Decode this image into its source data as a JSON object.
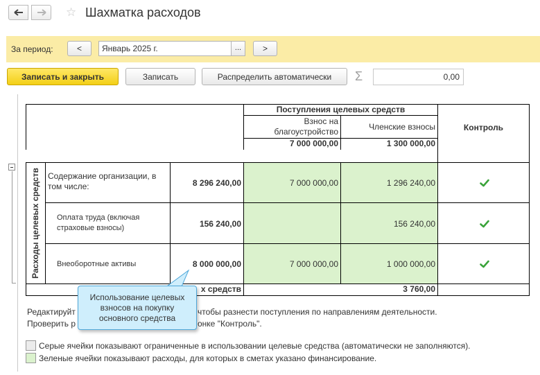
{
  "header": {
    "title": "Шахматка расходов"
  },
  "period": {
    "label": "За период:",
    "prev": "<",
    "next": ">",
    "value": "Январь 2025 г.",
    "picker": "..."
  },
  "toolbar": {
    "save_close": "Записать и закрыть",
    "save": "Записать",
    "auto_distribute": "Распределить автоматически",
    "sum_value": "0,00"
  },
  "grid": {
    "income_group": "Поступления целевых средств",
    "control_header": "Контроль",
    "columns": [
      {
        "label": "Взнос на благоустройство",
        "total": "7 000 000,00"
      },
      {
        "label": "Членские взносы",
        "total": "1 300 000,00"
      }
    ],
    "expense_group": "Расходы целевых средств",
    "rows": [
      {
        "name": "Содержание организации, в том числе:",
        "total": "8 296 240,00",
        "col1": "7 000 000,00",
        "col2": "1 296 240,00"
      },
      {
        "name": "Оплата труда (включая страховые взносы)",
        "total": "156 240,00",
        "col1": "",
        "col2": "156 240,00"
      },
      {
        "name": "Внеоборотные активы",
        "total": "8 000 000,00",
        "col1": "7 000 000,00",
        "col2": "1 000 000,00"
      }
    ],
    "remainder_label": "х средств",
    "remainder_value": "3 760,00"
  },
  "tooltip": {
    "text": "Использование целевых взносов на покупку основного средства"
  },
  "hints": {
    "line1_start": "Редактируйт",
    "line1_end": "чтобы разнести поступления по направлениям деятельности.",
    "line2_start": "Проверить р",
    "line2_end": "онке \"Контроль\"."
  },
  "legend": {
    "gray": "Серые ячейки показывают ограниченные в использовании целевые средства (автоматически не заполняются).",
    "green": "Зеленые ячейки показывают расходы, для которых в сметах указано финансирование."
  },
  "colors": {
    "accent_yellow": "#f3cf17",
    "period_bar": "#fbeca6",
    "green_cell": "#dbf2cd",
    "check": "#3aa33a",
    "tooltip_bg": "#cfeefc"
  }
}
